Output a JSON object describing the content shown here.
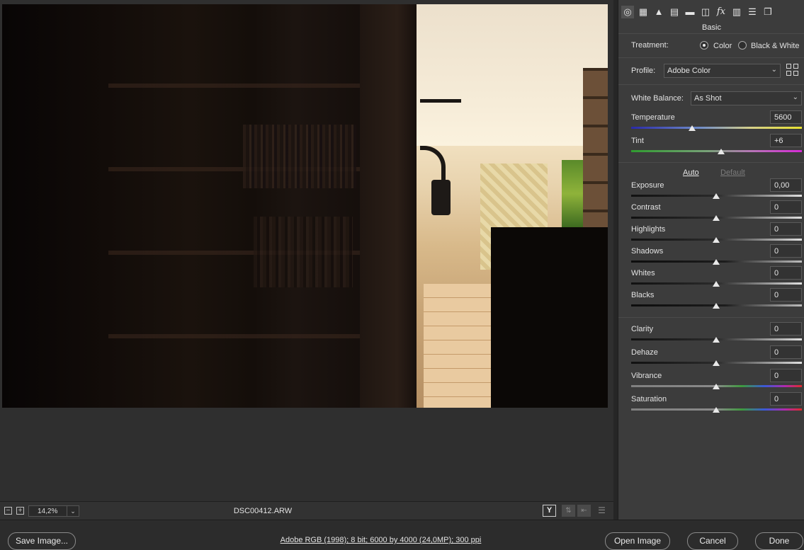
{
  "status_bar": {
    "zoom_out_symbol": "−",
    "zoom_in_symbol": "+",
    "zoom_value": "14,2%",
    "zoom_dropdown_symbol": "⌄",
    "filename": "DSC00412.ARW",
    "y_toggle_symbol": "Y"
  },
  "panel": {
    "title": "Basic",
    "tabs": [
      "basic-icon",
      "tone-curve-icon",
      "detail-icon",
      "hsl-icon",
      "split-toning-icon",
      "lens-corrections-icon",
      "effects-icon",
      "camera-calibration-icon",
      "presets-icon",
      "snapshots-icon"
    ],
    "treatment": {
      "label": "Treatment:",
      "options": [
        "Color",
        "Black & White"
      ],
      "selected": "Color"
    },
    "profile": {
      "label": "Profile:",
      "value": "Adobe Color"
    },
    "white_balance": {
      "label": "White Balance:",
      "value": "As Shot"
    },
    "temperature": {
      "label": "Temperature",
      "value": "5600"
    },
    "tint": {
      "label": "Tint",
      "value": "+6"
    },
    "auto_label": "Auto",
    "default_label": "Default",
    "tone": [
      {
        "label": "Exposure",
        "value": "0,00"
      },
      {
        "label": "Contrast",
        "value": "0"
      },
      {
        "label": "Highlights",
        "value": "0"
      },
      {
        "label": "Shadows",
        "value": "0"
      },
      {
        "label": "Whites",
        "value": "0"
      },
      {
        "label": "Blacks",
        "value": "0"
      }
    ],
    "presence": [
      {
        "label": "Clarity",
        "value": "0"
      },
      {
        "label": "Dehaze",
        "value": "0"
      },
      {
        "label": "Vibrance",
        "value": "0"
      },
      {
        "label": "Saturation",
        "value": "0"
      }
    ]
  },
  "bottom_bar": {
    "save_label": "Save Image...",
    "workflow_info": "Adobe RGB (1998); 8 bit; 6000 by 4000 (24,0MP); 300 ppi",
    "open_label": "Open Image",
    "cancel_label": "Cancel",
    "done_label": "Done"
  },
  "colors": {
    "panel_bg": "#3c3c3c",
    "app_bg": "#2b2b2b",
    "text": "#e2e2e2"
  }
}
